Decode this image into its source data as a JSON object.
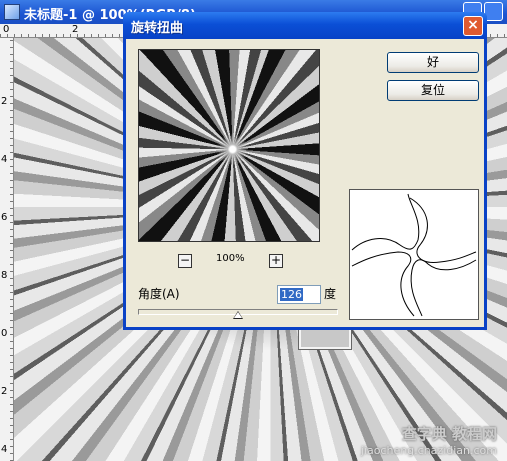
{
  "document": {
    "title": "未标题-1 @ 100%(RGB/8)",
    "ruler_top": [
      "0",
      "2"
    ],
    "ruler_left": [
      "2",
      "4",
      "6",
      "8",
      "0",
      "2",
      "4"
    ]
  },
  "dialog": {
    "title": "旋转扭曲",
    "close": "×",
    "ok_label": "好",
    "reset_label": "复位",
    "zoom_minus": "−",
    "zoom_plus": "+",
    "zoom_level": "100%",
    "angle_label": "角度(A)",
    "angle_value": "126",
    "angle_unit": "度",
    "slider_fraction": 0.5
  },
  "watermark": {
    "line1": "查字典 教程网",
    "line2": "jiaocheng.chazidian.com"
  }
}
